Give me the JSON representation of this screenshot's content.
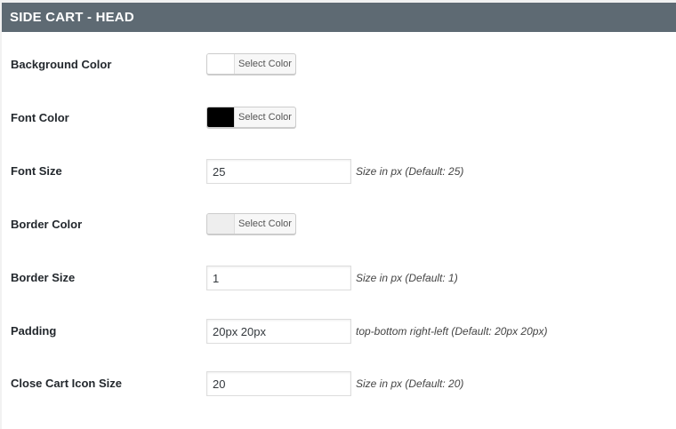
{
  "section": {
    "title": "SIDE CART - HEAD"
  },
  "fields": {
    "background_color": {
      "label": "Background Color",
      "button_label": "Select Color",
      "swatch_color": "#ffffff"
    },
    "font_color": {
      "label": "Font Color",
      "button_label": "Select Color",
      "swatch_color": "#000000"
    },
    "font_size": {
      "label": "Font Size",
      "value": "25",
      "hint": "Size in px (Default: 25)"
    },
    "border_color": {
      "label": "Border Color",
      "button_label": "Select Color",
      "swatch_color": "#eeeeee"
    },
    "border_size": {
      "label": "Border Size",
      "value": "1",
      "hint": "Size in px (Default: 1)"
    },
    "padding": {
      "label": "Padding",
      "value": "20px 20px",
      "hint": "top-bottom right-left (Default: 20px 20px)"
    },
    "close_icon_size": {
      "label": "Close Cart Icon Size",
      "value": "20",
      "hint": "Size in px (Default: 20)"
    }
  },
  "colors": {
    "header_bg": "#5e6a73",
    "header_text": "#ffffff"
  }
}
